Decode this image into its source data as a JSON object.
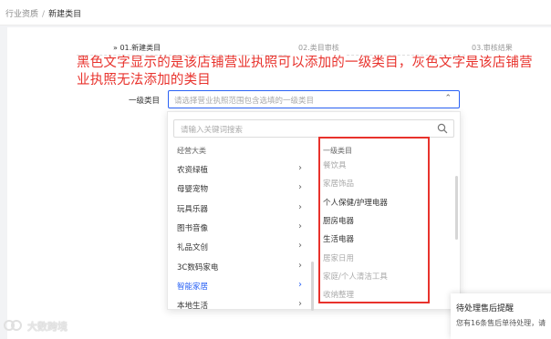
{
  "breadcrumb": {
    "parent": "行业资质",
    "separator": "/",
    "current": "新建类目"
  },
  "steps": [
    {
      "label": "» 01.新建类目"
    },
    {
      "label": "02.类目审核"
    },
    {
      "label": "03.审核结果"
    }
  ],
  "annotation": "黑色文字显示的是该店铺营业执照可以添加的一级类目，灰色文字是该店铺营业执照无法添加的类目",
  "form": {
    "label": "一级类目",
    "placeholder": "请选择营业执照范围包含选填的一级类目"
  },
  "dropdown": {
    "search_placeholder": "请输入关键词搜索",
    "left_header": "经营大类",
    "right_header": "一级类目",
    "left_items": [
      {
        "label": "农资绿植",
        "active": false
      },
      {
        "label": "母婴宠物",
        "active": false
      },
      {
        "label": "玩具乐器",
        "active": false
      },
      {
        "label": "图书音像",
        "active": false
      },
      {
        "label": "礼品文创",
        "active": false
      },
      {
        "label": "3C数码家电",
        "active": false
      },
      {
        "label": "智能家居",
        "active": true
      },
      {
        "label": "本地生活",
        "active": false
      }
    ],
    "right_items": [
      {
        "label": "餐饮具",
        "allowed": false
      },
      {
        "label": "家居饰品",
        "allowed": false
      },
      {
        "label": "个人保健/护理电器",
        "allowed": true
      },
      {
        "label": "厨房电器",
        "allowed": true
      },
      {
        "label": "生活电器",
        "allowed": true
      },
      {
        "label": "居家日用",
        "allowed": false
      },
      {
        "label": "家庭/个人清洁工具",
        "allowed": false
      },
      {
        "label": "收纳整理",
        "allowed": false
      }
    ]
  },
  "toast": {
    "title": "待处理售后提醒",
    "body": "您有16条售后单待处理，请"
  },
  "watermark": {
    "text": "大数跨境"
  },
  "colors": {
    "accent": "#2a62f5",
    "annotation": "#e8322c",
    "allowed_text": "#333333",
    "disallowed_text": "#aaaaaa"
  },
  "icons": {
    "dropdown": "chevron-up-icon",
    "search": "search-icon",
    "row_arrow": "chevron-right-icon"
  }
}
